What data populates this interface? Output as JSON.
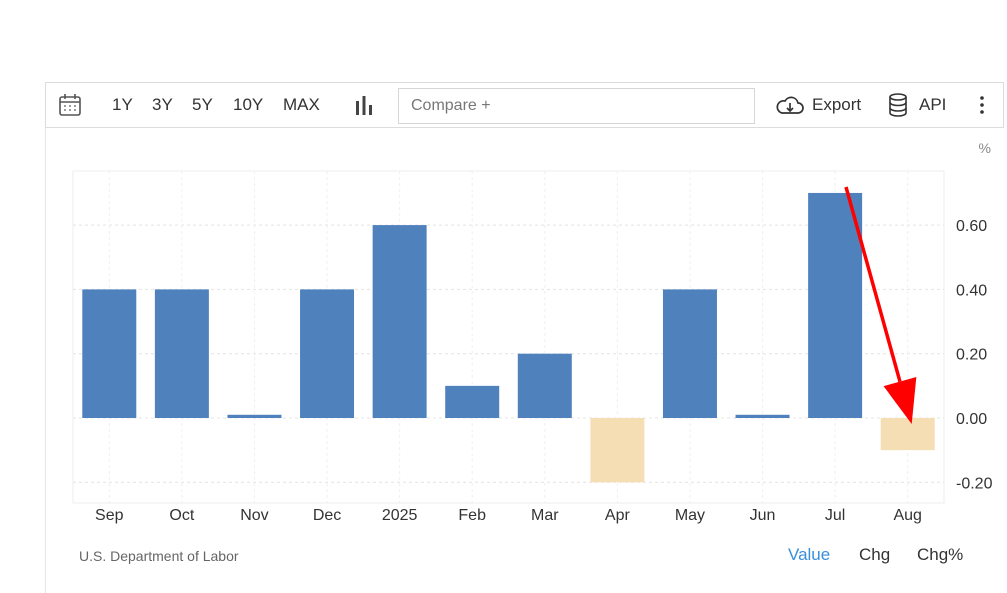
{
  "toolbar": {
    "icons": {
      "calendar": "calendar-icon",
      "chart_type": "bar-chart-icon",
      "export": "cloud-download-icon",
      "api": "database-icon",
      "more": "more-vertical-icon"
    },
    "ranges": [
      "1Y",
      "3Y",
      "5Y",
      "10Y",
      "MAX"
    ],
    "compare_placeholder": "Compare +",
    "export_label": "Export",
    "api_label": "API"
  },
  "footer": {
    "source": "U.S. Department of Labor",
    "views": [
      "Value",
      "Chg",
      "Chg%"
    ],
    "active_view": "Value"
  },
  "colors": {
    "positive_bar": "#4f81bd",
    "negative_bar": "#f5deb3",
    "active_link": "#3a8fd9",
    "annotation_arrow": "#ff0000"
  },
  "chart_data": {
    "type": "bar",
    "unit": "%",
    "categories": [
      "Sep",
      "Oct",
      "Nov",
      "Dec",
      "2025",
      "Feb",
      "Mar",
      "Apr",
      "May",
      "Jun",
      "Jul",
      "Aug"
    ],
    "values": [
      0.4,
      0.4,
      0.01,
      0.4,
      0.6,
      0.1,
      0.2,
      -0.2,
      0.4,
      0.01,
      0.7,
      -0.1
    ],
    "y_ticks": [
      "0.60",
      "0.40",
      "0.20",
      "0.00",
      "-0.20"
    ],
    "ylim": [
      -0.265,
      0.765
    ],
    "y_axis_side": "right",
    "grid": true,
    "annotation": "red arrow pointing to the Aug bar"
  }
}
